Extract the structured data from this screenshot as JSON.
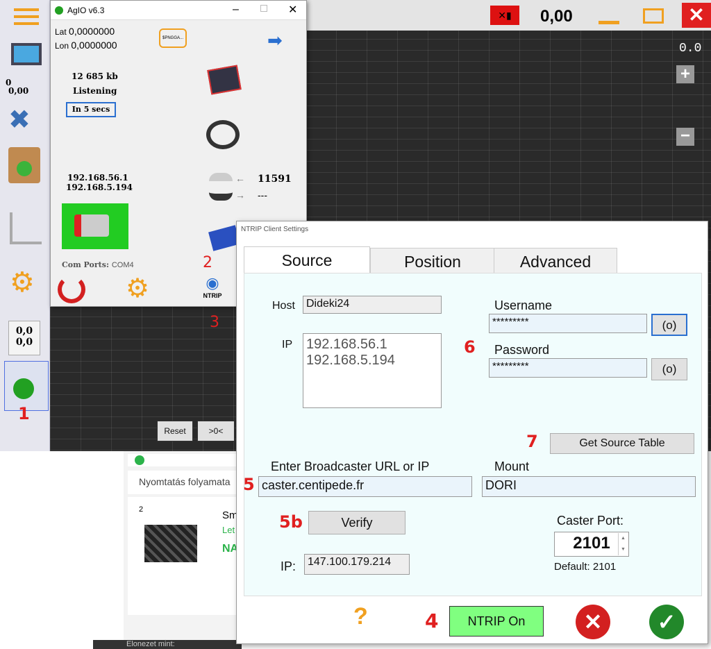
{
  "agopen": {
    "speed": "0,00",
    "right_readout": "0.0",
    "left_zero": "0",
    "left_speed": "0,00",
    "xy_line1": "0,0",
    "xy_line2": "0,0"
  },
  "agio": {
    "title": "AgIO v6.3",
    "lat_label": "Lat",
    "lat_value": "0,0000000",
    "lon_label": "Lon",
    "lon_value": "0,0000000",
    "nmea_badge": "$PNGGA...",
    "traffic": "12 685 kb",
    "status": "Listening",
    "countdown": "In 5 secs",
    "ip1": "192.168.56.1",
    "ip2": "192.168.5.194",
    "udp_in": "11591",
    "udp_out": "---",
    "com_ports_label": "Com Ports:",
    "com_ports_value": "COM4",
    "ntrip_label": "NTRIP",
    "reset_button": "Reset",
    "zero_button": ">0<"
  },
  "browser": {
    "section_title": "Nyomtatás folyamata",
    "item_num": "2",
    "item_title": "Sm",
    "item_sub": "Let",
    "item_status": "NA",
    "footer": "Elonezet mint:"
  },
  "ntrip": {
    "title": "NTRIP Client Settings",
    "tabs": [
      "Source",
      "Position",
      "Advanced"
    ],
    "host_label": "Host",
    "host_value": "Dideki24",
    "ip_label": "IP",
    "ip_list": [
      "192.168.56.1",
      "192.168.5.194"
    ],
    "username_label": "Username",
    "username_value": "*********",
    "show_button": "(o)",
    "password_label": "Password",
    "password_value": "*********",
    "get_source_table": "Get Source Table",
    "broadcaster_label": "Enter Broadcaster URL or IP",
    "broadcaster_value": "caster.centipede.fr",
    "mount_label": "Mount",
    "mount_value": "DORI",
    "verify_button": "Verify",
    "caster_port_label": "Caster Port:",
    "caster_port_value": "2101",
    "default_port": "Default: 2101",
    "resolved_ip_label": "IP:",
    "resolved_ip_value": "147.100.179.214",
    "help": "?",
    "ntrip_on_button": "NTRIP On"
  },
  "annotations": {
    "n1": "1",
    "n2": "2",
    "n3": "3",
    "n4": "4",
    "n5": "5",
    "n5b": "5b",
    "n6": "6",
    "n7": "7"
  },
  "colors": {
    "accent_green": "#22bb22",
    "ntrip_on": "#80ff80",
    "annotation_red": "#e02020"
  }
}
